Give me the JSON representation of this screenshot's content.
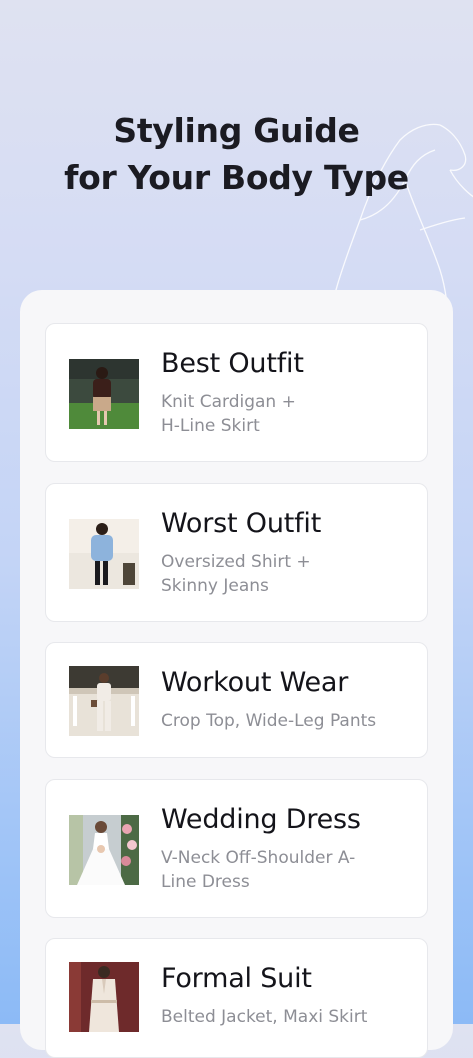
{
  "header": {
    "title_line1": "Styling Guide",
    "title_line2": "for Your Body Type"
  },
  "cards": [
    {
      "title": "Best Outfit",
      "desc_line1": "Knit Cardigan +",
      "desc_line2": "H-Line Skirt",
      "image": "woman-brown-cardigan-beige-skirt-photo"
    },
    {
      "title": "Worst Outfit",
      "desc_line1": "Oversized Shirt +",
      "desc_line2": "Skinny Jeans",
      "image": "woman-blue-oversized-shirt-photo"
    },
    {
      "title": "Workout Wear",
      "desc_line1": "Crop Top, Wide-Leg Pants",
      "desc_line2": "",
      "image": "woman-white-pantsuit-photo"
    },
    {
      "title": "Wedding Dress",
      "desc_line1": "V-Neck Off-Shoulder A-",
      "desc_line2": "Line Dress",
      "image": "bride-white-dress-flowers-photo"
    },
    {
      "title": "Formal Suit",
      "desc_line1": "Belted Jacket, Maxi Skirt",
      "desc_line2": "",
      "image": "woman-cream-formal-suit-photo"
    }
  ],
  "colors": {
    "background_top": "#dfe2f1",
    "background_bottom": "#8cbaf6",
    "panel": "#f7f7f9",
    "card": "#ffffff",
    "title_text": "#1b1b22",
    "desc_text": "#8d8e95"
  }
}
